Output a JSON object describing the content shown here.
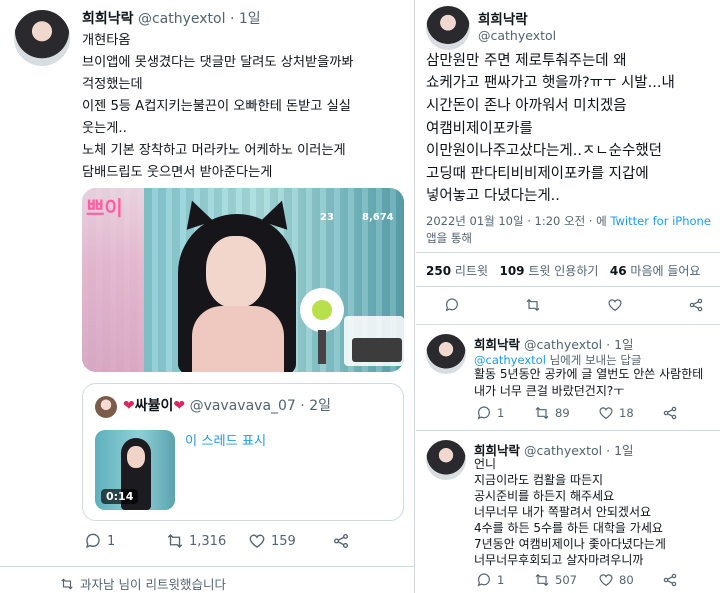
{
  "main_tweet": {
    "display_name": "희희낙락",
    "handle": "@cathyextol",
    "separator": "·",
    "time": "1일",
    "lines": [
      "개현타옴",
      "브이앱에 못생겼다는 댓글만 달려도 상처받을까봐",
      "걱정했는데",
      "이젠 5등 A컵지키는불끈이 오빠한테 돈받고 실실",
      "웃는게..",
      "노체 기본 장착하고 머라카노 어케하노 이러는게",
      "담배드립도 웃으면서 받아준다는게"
    ],
    "stream_overlay": {
      "title_badge": "쁘이",
      "count_left": "23",
      "count_right": "8,674"
    },
    "quoted": {
      "display_name": "싸뷸이",
      "handle": "@vavavava_07",
      "separator": "·",
      "time": "2일",
      "show_thread": "이 스레드 표시",
      "video_duration": "0:14"
    },
    "actions": {
      "replies": "1",
      "retweets": "1,316",
      "likes": "159"
    },
    "retweeted_by": "과자남 님이 리트윗했습니다"
  },
  "detail_tweet": {
    "display_name": "희희낙락",
    "handle": "@cathyextol",
    "lines": [
      "삼만원만 주면 제로투춰주는데 왜",
      "쇼케가고 팬싸가고 햇을까?ㅠㅜ 시발...내",
      "시간돈이 존나 아까워서 미치겠음",
      "여캠비제이포카를",
      "이만원이나주고샀다는게..ㅈㄴ순수했던",
      "고딩때 판다티비비제이포카를 지갑에",
      "넣어놓고 다녔다는게.."
    ],
    "timestamp": "2022년 01월 10일 · 1:20 오전 · 에",
    "source": "Twitter for iPhone",
    "via": "앱을 통해",
    "stats": {
      "retweets_count": "250",
      "retweets_label": "리트윗",
      "quotes_count": "109",
      "quotes_label": "트윗 인용하기",
      "likes_count": "46",
      "likes_label": "마음에 들어요"
    }
  },
  "reply1": {
    "display_name": "희희낙락",
    "handle": "@cathyextol",
    "separator": "·",
    "time": "1일",
    "replying_to": "@cathyextol",
    "replying_suffix": "님에게 보내는 답글",
    "lines": [
      "활동 5년동안 공카에 글 열번도 안쓴 사람한테",
      "내가 너무 큰걸 바랐던건지?ㅜ"
    ],
    "actions": {
      "replies": "1",
      "retweets": "89",
      "likes": "18"
    }
  },
  "reply2": {
    "display_name": "희희낙락",
    "handle": "@cathyextol",
    "separator": "·",
    "time": "1일",
    "lines": [
      "언니",
      "지금이라도 컴활을 따든지",
      "공시준비를 하든지 해주세요",
      "너무너무 내가 쪽팔려서 안되겠서요",
      "4수를 하든 5수를 하든 대학을 가세요",
      "7년동안 여캠비제이나 좇아다녔다는게",
      "너무너무후회되고 살자마려우니까"
    ],
    "actions": {
      "replies": "1",
      "retweets": "507",
      "likes": "80"
    }
  }
}
